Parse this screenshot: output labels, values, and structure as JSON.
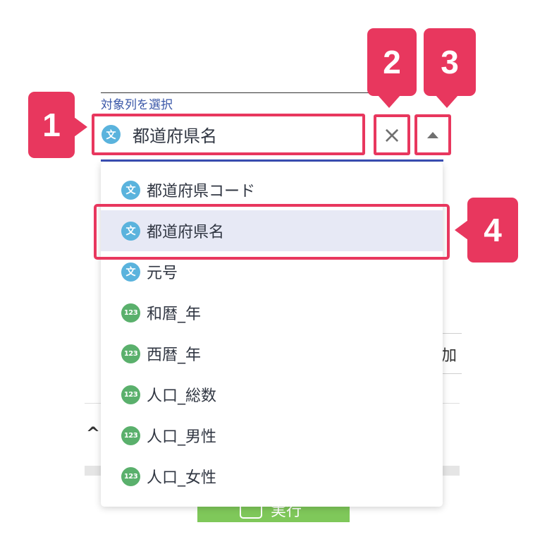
{
  "background": {
    "right_partial_text": "加",
    "chevron_glyph": "^",
    "run_button_label": "実行"
  },
  "field": {
    "label": "対象列を選択",
    "selected_value": "都道府県名",
    "selected_type_badge": "文",
    "clear_glyph": "×"
  },
  "dropdown": {
    "options": [
      {
        "label": "都道府県コード",
        "type": "text",
        "badge": "文"
      },
      {
        "label": "都道府県名",
        "type": "text",
        "badge": "文",
        "highlighted": true
      },
      {
        "label": "元号",
        "type": "text",
        "badge": "文"
      },
      {
        "label": "和暦_年",
        "type": "number",
        "badge": "123"
      },
      {
        "label": "西暦_年",
        "type": "number",
        "badge": "123"
      },
      {
        "label": "人口_総数",
        "type": "number",
        "badge": "123"
      },
      {
        "label": "人口_男性",
        "type": "number",
        "badge": "123"
      },
      {
        "label": "人口_女性",
        "type": "number",
        "badge": "123"
      }
    ]
  },
  "annotations": {
    "markers": [
      "1",
      "2",
      "3",
      "4"
    ]
  },
  "colors": {
    "annotation": "#e8375e",
    "text_type_badge": "#5ab3dd",
    "number_type_badge": "#5ab06c",
    "highlight_row": "#e7e9f5",
    "label_blue": "#3a57a8",
    "underline": "#3a4fb6"
  }
}
